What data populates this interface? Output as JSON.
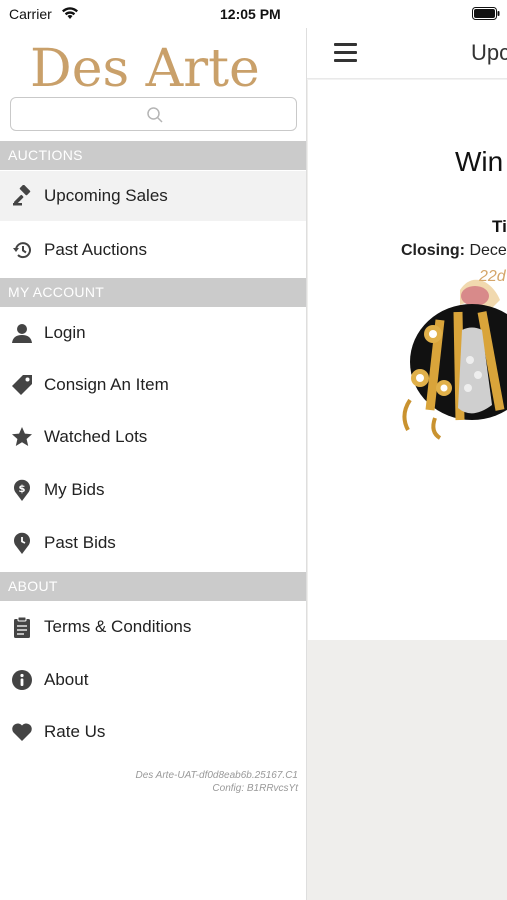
{
  "status_bar": {
    "carrier": "Carrier",
    "time": "12:05 PM"
  },
  "drawer": {
    "logo_text": "Des Arte",
    "search_placeholder": "",
    "sections": [
      {
        "title": "AUCTIONS",
        "items": [
          {
            "label": "Upcoming Sales",
            "icon": "gavel-icon",
            "active": true
          },
          {
            "label": "Past Auctions",
            "icon": "history-icon",
            "active": false
          }
        ]
      },
      {
        "title": "MY ACCOUNT",
        "items": [
          {
            "label": "Login",
            "icon": "user-icon"
          },
          {
            "label": "Consign An Item",
            "icon": "tag-icon"
          },
          {
            "label": "Watched Lots",
            "icon": "star-icon"
          },
          {
            "label": "My Bids",
            "icon": "dollar-pin-icon"
          },
          {
            "label": "Past Bids",
            "icon": "clock-pin-icon"
          }
        ]
      },
      {
        "title": "ABOUT",
        "items": [
          {
            "label": "Terms & Conditions",
            "icon": "clipboard-icon"
          },
          {
            "label": "About",
            "icon": "info-icon"
          },
          {
            "label": "Rate Us",
            "icon": "heart-icon"
          }
        ]
      }
    ],
    "version_line1": "Des Arte-UAT-df0d8eab6b.25167.C1",
    "version_line2": "Config: B1RRvcsYt"
  },
  "main": {
    "nav_title": "Upc",
    "card": {
      "title": "Win",
      "subtitle": "Ti",
      "closing_label": "Closing:",
      "closing_value": "Dece",
      "countdown": "22d"
    }
  },
  "colors": {
    "logo_gold": "#c9a06a",
    "section_header_bg": "#cbcbcb",
    "active_row_bg": "#f2f2f2",
    "countdown_gold": "#d4a56a"
  }
}
